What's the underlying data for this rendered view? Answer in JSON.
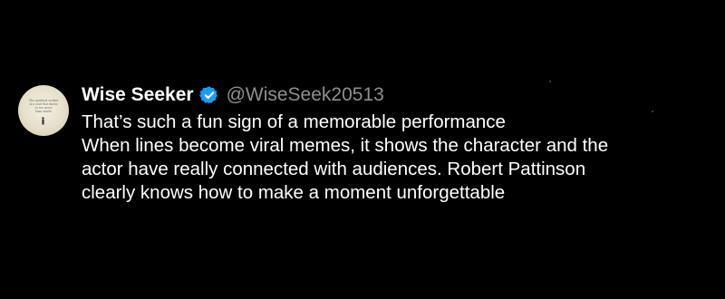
{
  "tweet": {
    "avatar_text": "The spiritual seeker\nis a soul that dares\nto see more\nthan doubt",
    "display_name": "Wise Seeker",
    "verified_icon": "verified-badge-icon",
    "handle": "@WiseSeek20513",
    "lines": [
      "That’s such a fun sign of a memorable performance",
      "When lines become viral memes, it shows the character and the",
      "actor have really connected with audiences. Robert Pattinson",
      "clearly knows how to make a moment unforgettable"
    ]
  },
  "colors": {
    "background": "#000000",
    "text": "#ffffff",
    "handle": "#8b8f94",
    "verified": "#1d9bf0"
  }
}
